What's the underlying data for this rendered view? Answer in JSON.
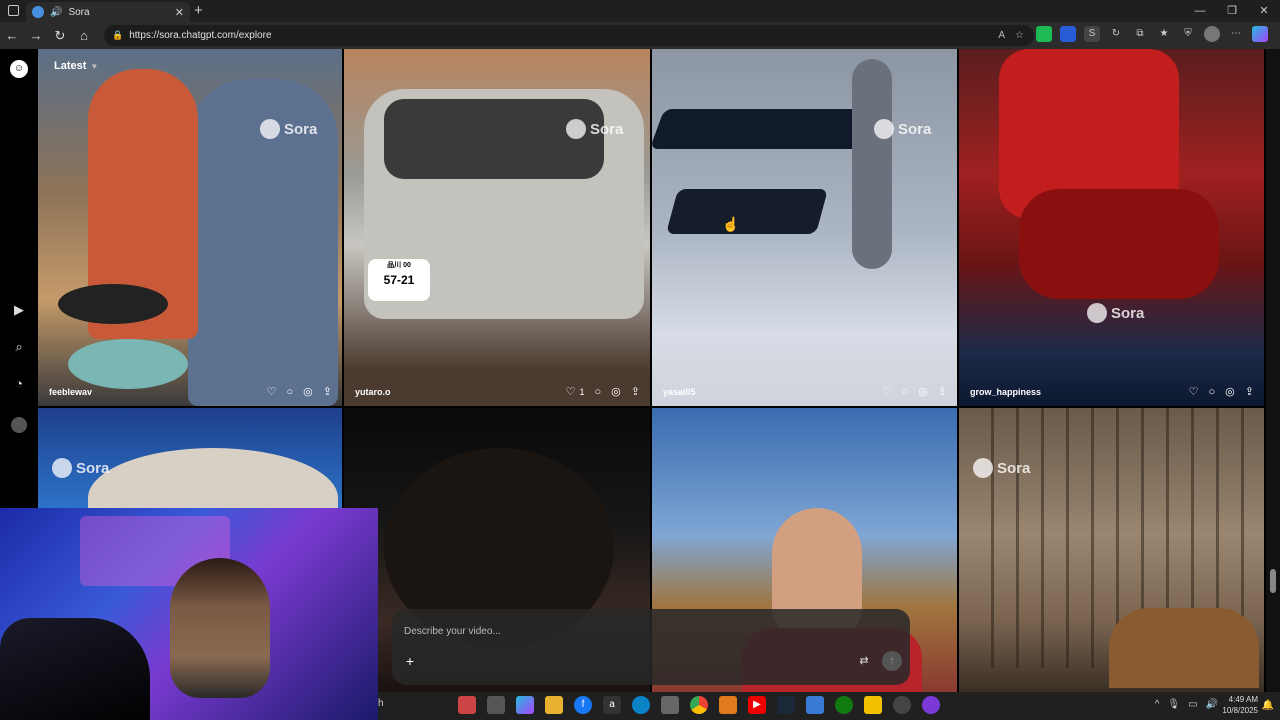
{
  "browser": {
    "tab_title": "Sora",
    "tab_close": "✕",
    "new_tab": "+",
    "url": "https://sora.chatgpt.com/explore",
    "window_controls": [
      "—",
      "❐",
      "✕"
    ]
  },
  "app": {
    "sort_label": "Latest",
    "tiles": [
      {
        "user": "feeblewav",
        "likes": "",
        "watermark": "Sora"
      },
      {
        "user": "yutaro.o",
        "likes": "1",
        "watermark": "Sora"
      },
      {
        "user": "yasai05",
        "likes": "",
        "watermark": "Sora"
      },
      {
        "user": "grow_happiness",
        "likes": "",
        "watermark": "Sora"
      },
      {
        "user": "",
        "likes": "",
        "watermark": "Sora"
      },
      {
        "user": "",
        "likes": "",
        "watermark": ""
      },
      {
        "user": "",
        "likes": "",
        "watermark": ""
      },
      {
        "user": "",
        "likes": "",
        "watermark": "Sora"
      }
    ],
    "car_plate": [
      "品川 00",
      "57-21"
    ]
  },
  "prompt": {
    "placeholder": "Describe your video..."
  },
  "taskbar": {
    "search_label": "h",
    "time": "4:49 AM",
    "date": "10/8/2025"
  }
}
